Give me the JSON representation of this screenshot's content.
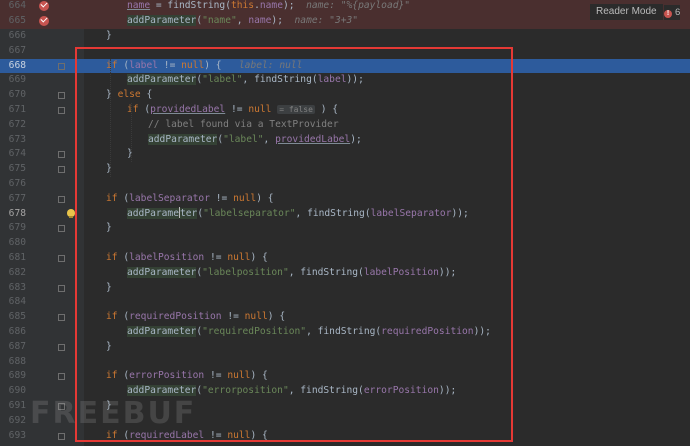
{
  "toolbar": {
    "reader_mode": "Reader Mode",
    "warnings": "6"
  },
  "watermark": "FREEBUF",
  "lines": [
    {
      "num": "664",
      "bp": true,
      "tokens": [
        [
          "",
          ""
        ],
        [
          "fld uline",
          "name"
        ],
        [
          "",
          " = findString("
        ],
        [
          "kw",
          "this"
        ],
        [
          "",
          "."
        ],
        [
          "fld",
          "name"
        ],
        [
          "",
          ");  "
        ],
        [
          "hint",
          "name: \"%{payload}\""
        ]
      ]
    },
    {
      "num": "665",
      "bp": true,
      "tokens": [
        [
          "call",
          "addParameter"
        ],
        [
          "",
          "("
        ],
        [
          "str",
          "\"name\""
        ],
        [
          "",
          ", "
        ],
        [
          "fld",
          "name"
        ],
        [
          "",
          ");  "
        ],
        [
          "hint",
          "name: \"3+3\""
        ]
      ]
    },
    {
      "num": "666",
      "tokens": [
        [
          "",
          "}"
        ]
      ]
    },
    {
      "num": "667",
      "tokens": []
    },
    {
      "num": "668",
      "hl": true,
      "tokens": [
        [
          "kw",
          "if"
        ],
        [
          "",
          " ("
        ],
        [
          "fld",
          "label"
        ],
        [
          "",
          " != "
        ],
        [
          "kw",
          "null"
        ],
        [
          "",
          ") {   "
        ],
        [
          "hint",
          "label: null"
        ]
      ]
    },
    {
      "num": "669",
      "tokens": [
        [
          "call",
          "addParameter"
        ],
        [
          "",
          "("
        ],
        [
          "str",
          "\"label\""
        ],
        [
          "",
          ", findString("
        ],
        [
          "fld",
          "label"
        ],
        [
          "",
          "));"
        ]
      ]
    },
    {
      "num": "670",
      "tokens": [
        [
          "",
          "} "
        ],
        [
          "kw",
          "else"
        ],
        [
          "",
          " {"
        ]
      ]
    },
    {
      "num": "671",
      "tokens": [
        [
          "kw",
          "if"
        ],
        [
          "",
          " ("
        ],
        [
          "fld uline",
          "providedLabel"
        ],
        [
          "",
          " != "
        ],
        [
          "kw",
          "null"
        ],
        [
          "",
          " "
        ],
        [
          "chip",
          "= false"
        ],
        [
          "",
          " ) {"
        ]
      ]
    },
    {
      "num": "672",
      "tokens": [
        [
          "cmt",
          "// label found via a TextProvider"
        ]
      ]
    },
    {
      "num": "673",
      "tokens": [
        [
          "call",
          "addParameter"
        ],
        [
          "",
          "("
        ],
        [
          "str",
          "\"label\""
        ],
        [
          "",
          ", "
        ],
        [
          "fld uline",
          "providedLabel"
        ],
        [
          "",
          ");"
        ]
      ]
    },
    {
      "num": "674",
      "tokens": [
        [
          "",
          "}"
        ]
      ]
    },
    {
      "num": "675",
      "tokens": [
        [
          "",
          "}"
        ]
      ]
    },
    {
      "num": "676",
      "tokens": []
    },
    {
      "num": "677",
      "tokens": [
        [
          "kw",
          "if"
        ],
        [
          "",
          " ("
        ],
        [
          "fld",
          "labelSeparator"
        ],
        [
          "",
          " != "
        ],
        [
          "kw",
          "null"
        ],
        [
          "",
          ") {"
        ]
      ]
    },
    {
      "num": "678",
      "current": true,
      "bulb": true,
      "tokens": [
        [
          "call",
          "addParame"
        ],
        [
          "caret",
          ""
        ],
        [
          "call",
          "ter"
        ],
        [
          "",
          "("
        ],
        [
          "str",
          "\"labelseparator\""
        ],
        [
          "",
          ", findString("
        ],
        [
          "fld",
          "labelSeparator"
        ],
        [
          "",
          "));"
        ]
      ]
    },
    {
      "num": "679",
      "tokens": [
        [
          "",
          "}"
        ]
      ]
    },
    {
      "num": "680",
      "tokens": []
    },
    {
      "num": "681",
      "tokens": [
        [
          "kw",
          "if"
        ],
        [
          "",
          " ("
        ],
        [
          "fld",
          "labelPosition"
        ],
        [
          "",
          " != "
        ],
        [
          "kw",
          "null"
        ],
        [
          "",
          ") {"
        ]
      ]
    },
    {
      "num": "682",
      "tokens": [
        [
          "call",
          "addParameter"
        ],
        [
          "",
          "("
        ],
        [
          "str",
          "\"labelposition\""
        ],
        [
          "",
          ", findString("
        ],
        [
          "fld",
          "labelPosition"
        ],
        [
          "",
          "));"
        ]
      ]
    },
    {
      "num": "683",
      "tokens": [
        [
          "",
          "}"
        ]
      ]
    },
    {
      "num": "684",
      "tokens": []
    },
    {
      "num": "685",
      "tokens": [
        [
          "kw",
          "if"
        ],
        [
          "",
          " ("
        ],
        [
          "fld",
          "requiredPosition"
        ],
        [
          "",
          " != "
        ],
        [
          "kw",
          "null"
        ],
        [
          "",
          ") {"
        ]
      ]
    },
    {
      "num": "686",
      "tokens": [
        [
          "call",
          "addParameter"
        ],
        [
          "",
          "("
        ],
        [
          "str",
          "\"requiredPosition\""
        ],
        [
          "",
          ", findString("
        ],
        [
          "fld",
          "requiredPosition"
        ],
        [
          "",
          "));"
        ]
      ]
    },
    {
      "num": "687",
      "tokens": [
        [
          "",
          "}"
        ]
      ]
    },
    {
      "num": "688",
      "tokens": []
    },
    {
      "num": "689",
      "tokens": [
        [
          "kw",
          "if"
        ],
        [
          "",
          " ("
        ],
        [
          "fld",
          "errorPosition"
        ],
        [
          "",
          " != "
        ],
        [
          "kw",
          "null"
        ],
        [
          "",
          ") {"
        ]
      ]
    },
    {
      "num": "690",
      "tokens": [
        [
          "call",
          "addParameter"
        ],
        [
          "",
          "("
        ],
        [
          "str",
          "\"errorposition\""
        ],
        [
          "",
          ", findString("
        ],
        [
          "fld",
          "errorPosition"
        ],
        [
          "",
          "));"
        ]
      ]
    },
    {
      "num": "691",
      "tokens": [
        [
          "",
          "}"
        ]
      ]
    },
    {
      "num": "692",
      "tokens": []
    },
    {
      "num": "693",
      "tokens": [
        [
          "kw",
          "if"
        ],
        [
          "",
          " ("
        ],
        [
          "fld",
          "requiredLabel"
        ],
        [
          "",
          " != "
        ],
        [
          "kw",
          "null"
        ],
        [
          "",
          ") {"
        ]
      ]
    }
  ]
}
